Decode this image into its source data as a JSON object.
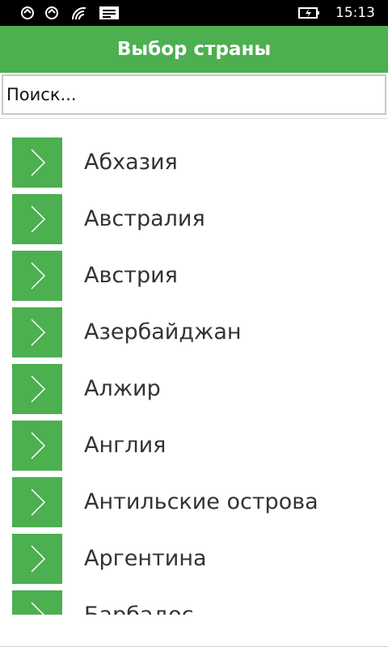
{
  "status_bar": {
    "time": "15:13",
    "icons": [
      "notification-icon",
      "notification-icon",
      "wifi-signal-icon",
      "message-icon",
      "battery-charging-icon"
    ]
  },
  "header": {
    "title": "Выбор страны"
  },
  "search": {
    "placeholder": "Поиск..."
  },
  "countries": [
    {
      "label": "Абхазия"
    },
    {
      "label": "Австралия"
    },
    {
      "label": "Австрия"
    },
    {
      "label": "Азербайджан"
    },
    {
      "label": "Алжир"
    },
    {
      "label": "Англия"
    },
    {
      "label": "Антильские острова"
    },
    {
      "label": "Аргентина"
    },
    {
      "label": "Барбадос"
    }
  ],
  "colors": {
    "accent": "#4caf50",
    "status_bar": "#000000",
    "text": "#333333"
  }
}
